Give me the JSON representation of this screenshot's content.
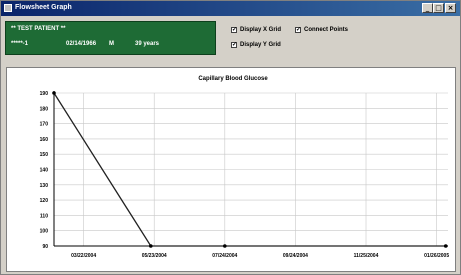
{
  "window": {
    "title": "Flowsheet Graph",
    "minimize": "_",
    "maximize": "□",
    "close": "×"
  },
  "patient": {
    "name": "** TEST PATIENT **",
    "id": "*****-1",
    "dob": "02/14/1966",
    "sex": "M",
    "age": "39 years"
  },
  "options": {
    "display_x_grid": {
      "label": "Display X Grid",
      "checked": true
    },
    "connect_points": {
      "label": "Connect Points",
      "checked": true
    },
    "display_y_grid": {
      "label": "Display Y Grid",
      "checked": true
    }
  },
  "colors": {
    "panel": "#1e6b35",
    "window": "#d4d0c8",
    "titlebar": "#0a246a",
    "line": "#222222"
  },
  "chart_data": {
    "type": "line",
    "title": "Capillary Blood Glucose",
    "xlabel": "",
    "ylabel": "",
    "ylim": [
      90,
      190
    ],
    "xlim": [
      "02/25/2004",
      "02/05/2005"
    ],
    "yticks": [
      90,
      100,
      110,
      120,
      130,
      140,
      150,
      160,
      170,
      180,
      190
    ],
    "xticks": [
      "03/22/2004",
      "05/23/2004",
      "07/24/2004",
      "09/24/2004",
      "11/25/2004",
      "01/26/2005"
    ],
    "grid": true,
    "series": [
      {
        "points": [
          {
            "x": "02/25/2004",
            "y": 190
          },
          {
            "x": "05/20/2004",
            "y": 90
          },
          {
            "x": "07/24/2004",
            "y": 90
          },
          {
            "x": "02/03/2005",
            "y": 90
          }
        ]
      }
    ]
  }
}
